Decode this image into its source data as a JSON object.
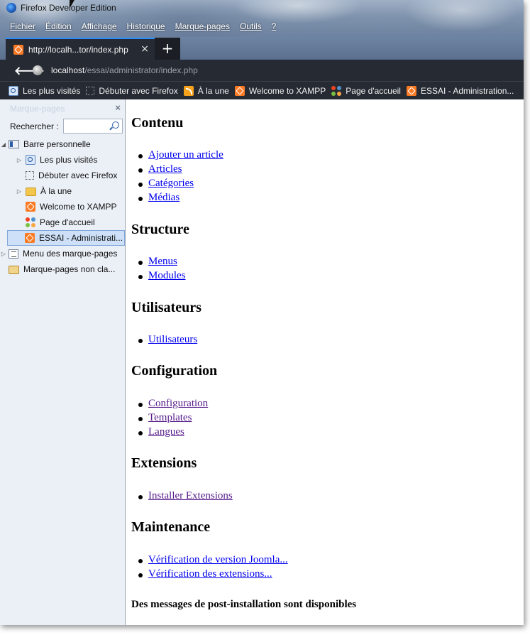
{
  "window": {
    "title": "Firefox Developer Edition"
  },
  "menubar": [
    "Fichier",
    "Édition",
    "Affichage",
    "Historique",
    "Marque-pages",
    "Outils",
    "?"
  ],
  "tab": {
    "title": "http://localh...tor/index.php",
    "close": "×",
    "new_tab": "+"
  },
  "navbar": {
    "back": "🡐",
    "url_host": "localhost",
    "url_path": "/essai/administrator/index.php"
  },
  "bookmarks_toolbar": [
    {
      "label": "Les plus visités",
      "icon": "most-visited-icon"
    },
    {
      "label": "Débuter avec Firefox",
      "icon": "page-icon"
    },
    {
      "label": "À la une",
      "icon": "rss-icon"
    },
    {
      "label": "Welcome to XAMPP",
      "icon": "xampp-icon"
    },
    {
      "label": "Page d'accueil",
      "icon": "joomla-icon"
    },
    {
      "label": "ESSAI - Administration...",
      "icon": "xampp-icon"
    }
  ],
  "sidebar": {
    "title": "Marque-pages",
    "close": "×",
    "search_label": "Rechercher :",
    "search_value": "",
    "tree": [
      {
        "label": "Barre personnelle",
        "level": 0,
        "expanded": true
      },
      {
        "label": "Les plus visités",
        "level": 1
      },
      {
        "label": "Débuter avec Firefox",
        "level": 1
      },
      {
        "label": "À la une",
        "level": 1
      },
      {
        "label": "Welcome to XAMPP",
        "level": 1
      },
      {
        "label": "Page d'accueil",
        "level": 1
      },
      {
        "label": "ESSAI - Administrati...",
        "level": 1,
        "selected": true
      },
      {
        "label": "Menu des marque-pages",
        "level": 0
      },
      {
        "label": "Marque-pages non cla...",
        "level": 0
      }
    ]
  },
  "content": {
    "sections": [
      {
        "heading": "Contenu",
        "links": [
          "Ajouter un article",
          "Articles",
          "Catégories",
          "Médias"
        ]
      },
      {
        "heading": "Structure",
        "links": [
          "Menus",
          "Modules"
        ]
      },
      {
        "heading": "Utilisateurs",
        "links": [
          "Utilisateurs"
        ]
      },
      {
        "heading": "Configuration",
        "links": [
          "Configuration",
          "Templates",
          "Langues"
        ]
      },
      {
        "heading": "Extensions",
        "links": [
          "Installer Extensions"
        ]
      },
      {
        "heading": "Maintenance",
        "links": [
          "Vérification de version Joomla...",
          "Vérification des extensions..."
        ]
      }
    ],
    "post_install_message": "Des messages de post-installation sont disponibles"
  },
  "colors": {
    "link": "#0000ee",
    "visited": "#551a8b",
    "chrome_dark": "#262a33",
    "tab_accent": "#2a8cff",
    "sidebar_bg": "#ebf0f7"
  }
}
